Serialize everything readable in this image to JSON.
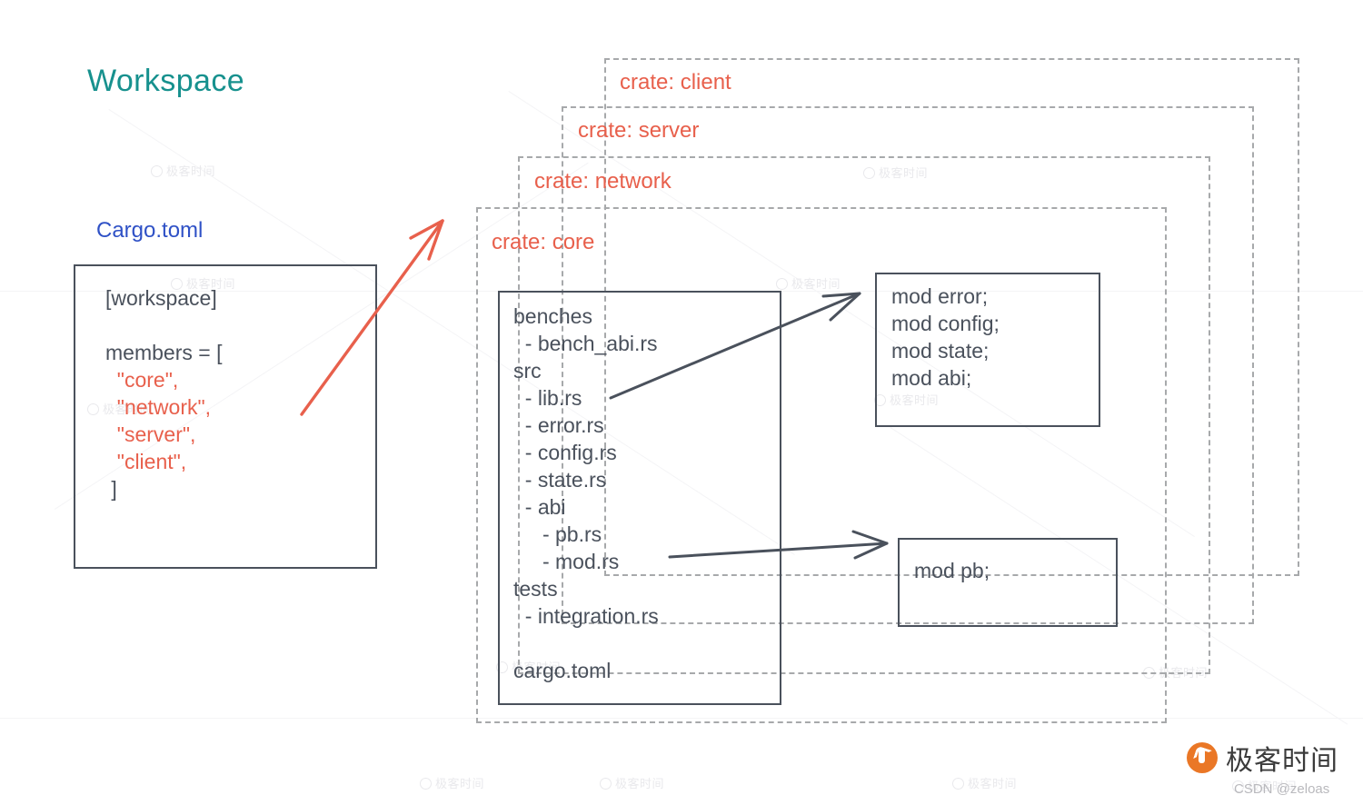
{
  "diagram": {
    "title": "Workspace",
    "cargo_toml_label": "Cargo.toml",
    "title_color": "#17918e",
    "cargo_label_color": "#2f51c6",
    "crate_label_color": "#e8604c",
    "string_color": "#e8604c",
    "box_border_color": "#4a515c",
    "dashed_border_color": "#a7a9ab"
  },
  "cargo_toml_box": {
    "line_workspace": "[workspace]",
    "line_blank": "",
    "line_members_open": "members = [",
    "member_core": "\"core\",",
    "member_network": "\"network\",",
    "member_server": "\"server\",",
    "member_client": "\"client\",",
    "line_close": "]"
  },
  "crates": [
    {
      "label": "crate: client"
    },
    {
      "label": "crate: server"
    },
    {
      "label": "crate: network"
    },
    {
      "label": "crate: core"
    }
  ],
  "file_tree_box": {
    "lines": [
      "benches",
      "  - bench_abi.rs",
      "src",
      "  - lib.rs",
      "  - error.rs",
      "  - config.rs",
      "  - state.rs",
      "  - abi",
      "     - pb.rs",
      "     - mod.rs",
      "tests",
      "  - integration.rs",
      "",
      "cargo.toml"
    ],
    "text": "benches\n  - bench_abi.rs\nsrc\n  - lib.rs\n  - error.rs\n  - config.rs\n  - state.rs\n  - abi\n     - pb.rs\n     - mod.rs\ntests\n  - integration.rs\n\ncargo.toml"
  },
  "lib_mods_box": {
    "lines": [
      "mod error;",
      "mod config;",
      "mod state;",
      "mod abi;"
    ],
    "text": "mod error;\nmod config;\nmod state;\nmod abi;"
  },
  "abi_mods_box": {
    "lines": [
      "mod pb;"
    ],
    "text": "mod pb;"
  },
  "arrows": {
    "workspace_to_crates": {
      "color": "#e8604c"
    },
    "libts_to_mods": {
      "color": "#4a515c"
    },
    "modrs_to_pb": {
      "color": "#4a515c"
    }
  },
  "branding": {
    "logo_text": "极客时间",
    "credit": "CSDN @zeloas",
    "watermark_text": "极客时间"
  }
}
